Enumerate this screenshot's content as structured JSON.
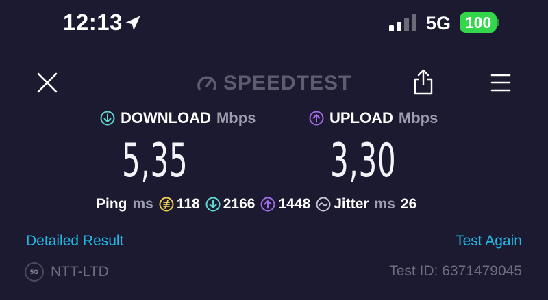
{
  "status_bar": {
    "time": "12:13",
    "network": "5G",
    "battery": "100",
    "battery_color": "#32d74b"
  },
  "header": {
    "logo_text": "SPEEDTEST",
    "close_icon": "close-icon",
    "share_icon": "share-icon",
    "menu_icon": "menu-icon"
  },
  "download": {
    "label": "DOWNLOAD",
    "unit": "Mbps",
    "value": "5,35",
    "color": "#5fd8d0"
  },
  "upload": {
    "label": "UPLOAD",
    "unit": "Mbps",
    "value": "3,30",
    "color": "#a46be8"
  },
  "stats": {
    "ping_label": "Ping",
    "ping_unit": "ms",
    "ping_value": "118",
    "download_latency": "2166",
    "upload_latency": "1448",
    "jitter_label": "Jitter",
    "jitter_unit": "ms",
    "jitter_value": "26"
  },
  "actions": {
    "detailed_result": "Detailed Result",
    "test_again": "Test Again",
    "link_color": "#22b8e6"
  },
  "footer": {
    "isp_badge": "5G",
    "isp_name": "NTT-LTD",
    "test_id": "Test ID: 6371479045"
  }
}
